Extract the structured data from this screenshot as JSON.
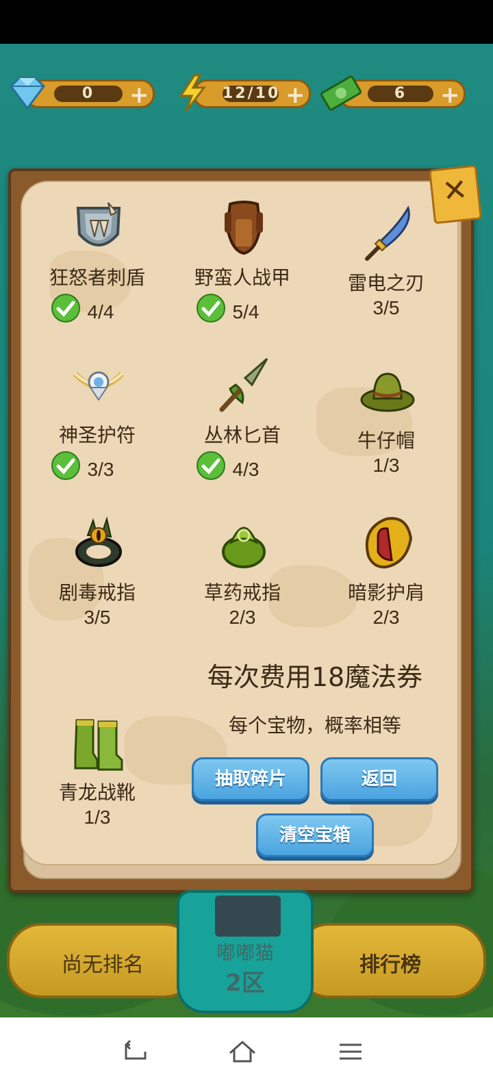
{
  "resources": [
    {
      "name": "gems",
      "value": "0",
      "icon": "diamond-icon"
    },
    {
      "name": "energy",
      "value": "12/10",
      "icon": "lightning-icon"
    },
    {
      "name": "cash",
      "value": "6",
      "icon": "money-icon"
    }
  ],
  "dialog": {
    "items": [
      {
        "name": "狂怒者刺盾",
        "count": "4/4",
        "complete": true,
        "icon": "spiked-shield-icon"
      },
      {
        "name": "野蛮人战甲",
        "count": "5/4",
        "complete": true,
        "icon": "armor-icon"
      },
      {
        "name": "雷电之刃",
        "count": "3/5",
        "complete": false,
        "icon": "blade-icon"
      },
      {
        "name": "神圣护符",
        "count": "3/3",
        "complete": true,
        "icon": "amulet-icon"
      },
      {
        "name": "丛林匕首",
        "count": "4/3",
        "complete": true,
        "icon": "dagger-icon"
      },
      {
        "name": "牛仔帽",
        "count": "1/3",
        "complete": false,
        "icon": "cowboy-hat-icon"
      },
      {
        "name": "剧毒戒指",
        "count": "3/5",
        "complete": false,
        "icon": "poison-ring-icon"
      },
      {
        "name": "草药戒指",
        "count": "2/3",
        "complete": false,
        "icon": "herb-ring-icon"
      },
      {
        "name": "暗影护肩",
        "count": "2/3",
        "complete": false,
        "icon": "shoulder-guard-icon"
      },
      {
        "name": "青龙战靴",
        "count": "1/3",
        "complete": false,
        "icon": "boots-icon"
      }
    ],
    "cost_text": "每次费用18魔法券",
    "odds_text": "每个宝物，概率相等",
    "draw_button": "抽取碎片",
    "back_button": "返回",
    "clear_button": "清空宝箱",
    "close_icon": "close-icon"
  },
  "bottom": {
    "left_label": "尚无排名",
    "right_label": "排行榜",
    "player_name": "嘟嘟猫",
    "zone": "2区"
  },
  "colors": {
    "accent_gold": "#d99b2a",
    "button_blue": "#4aa3df",
    "check_green": "#5bbf3a",
    "parchment": "#ecd7b6"
  }
}
